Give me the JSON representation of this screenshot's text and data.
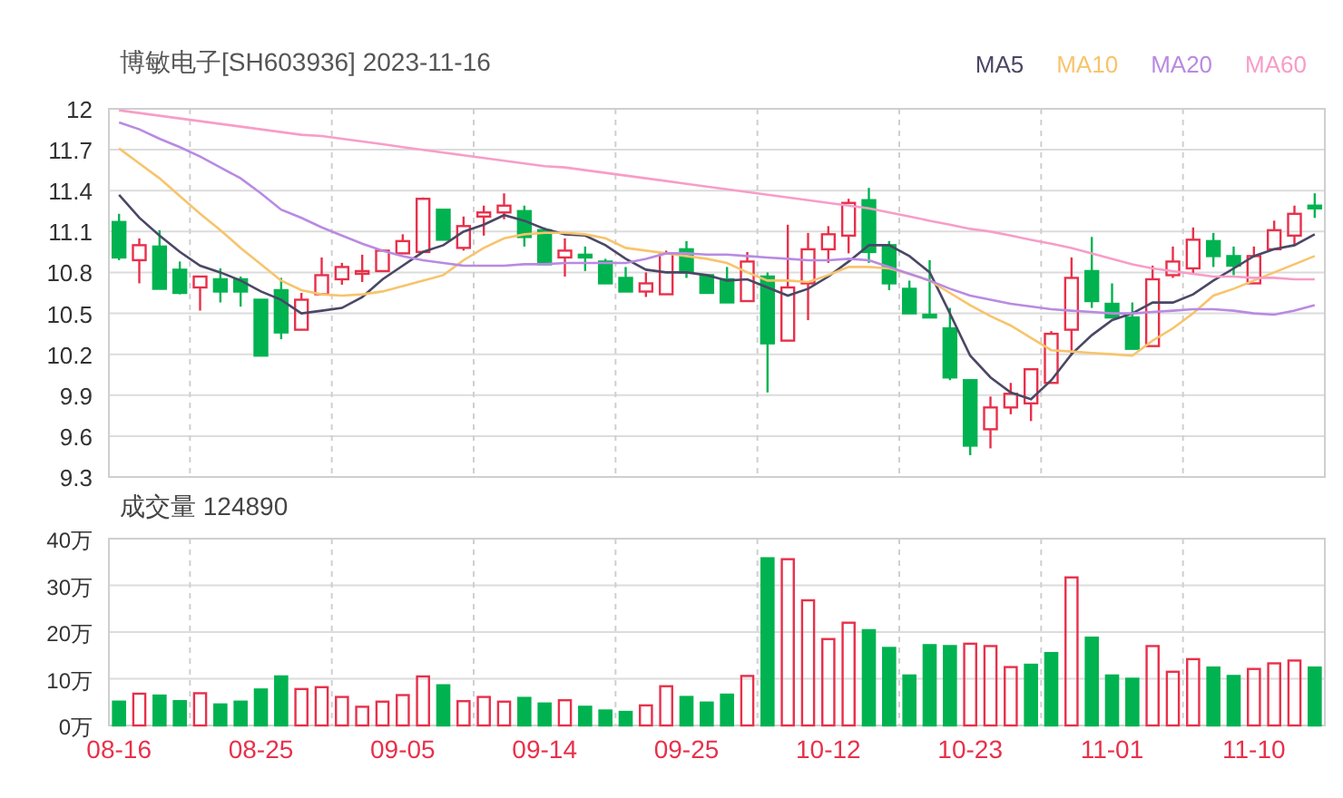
{
  "title": "博敏电子[SH603936] 2023-11-16",
  "price_chart": {
    "candles": {
      "chart_data": {
        "type": "candlestick",
        "grid": true,
        "categories": [
          null,
          null,
          null,
          null,
          null,
          null,
          null,
          null,
          null,
          null,
          null,
          null,
          null,
          null,
          null,
          null,
          null,
          null,
          null,
          null,
          null,
          null,
          null,
          null,
          null,
          null,
          null,
          null,
          null,
          null,
          null,
          null,
          null,
          null,
          null,
          null,
          null,
          null,
          null,
          null,
          null,
          null,
          null,
          null,
          null,
          null,
          null,
          null,
          null,
          null,
          null,
          null,
          null,
          null,
          null,
          null,
          null,
          null,
          null,
          null
        ],
        "ylim": [
          9.3,
          12
        ],
        "yticks": [
          {
            "value": 12,
            "label": "12"
          },
          {
            "value": 11.7,
            "label": "11.7"
          },
          {
            "value": 11.4,
            "label": "11.4"
          },
          {
            "value": 11.1,
            "label": "11.1"
          },
          {
            "value": 10.8,
            "label": "10.8"
          },
          {
            "value": 10.5,
            "label": "10.5"
          },
          {
            "value": 10.2,
            "label": "10.2"
          },
          {
            "value": 9.9,
            "label": "9.9"
          },
          {
            "value": 9.6,
            "label": "9.6"
          },
          {
            "value": 9.3,
            "label": "9.3"
          }
        ],
        "ohlc": [
          [
            11.17,
            11.23,
            10.89,
            10.91
          ],
          [
            10.89,
            11.05,
            10.72,
            11.0
          ],
          [
            10.99,
            11.11,
            10.68,
            10.68
          ],
          [
            10.82,
            10.88,
            10.64,
            10.65
          ],
          [
            10.69,
            10.77,
            10.52,
            10.77
          ],
          [
            10.75,
            10.83,
            10.58,
            10.66
          ],
          [
            10.75,
            10.77,
            10.55,
            10.66
          ],
          [
            10.6,
            10.6,
            10.19,
            10.19
          ],
          [
            10.67,
            10.76,
            10.31,
            10.36
          ],
          [
            10.38,
            10.65,
            10.38,
            10.6
          ],
          [
            10.64,
            10.91,
            10.64,
            10.78
          ],
          [
            10.75,
            10.87,
            10.71,
            10.84
          ],
          [
            10.8,
            10.93,
            10.73,
            10.81
          ],
          [
            10.81,
            10.97,
            10.81,
            10.96
          ],
          [
            10.94,
            11.08,
            10.94,
            11.03
          ],
          [
            10.95,
            11.35,
            10.95,
            11.34
          ],
          [
            11.26,
            11.26,
            11.04,
            11.04
          ],
          [
            10.98,
            11.21,
            10.96,
            11.14
          ],
          [
            11.21,
            11.29,
            11.07,
            11.24
          ],
          [
            11.24,
            11.38,
            11.19,
            11.29
          ],
          [
            11.25,
            11.29,
            10.99,
            11.06
          ],
          [
            11.11,
            11.13,
            10.86,
            10.86
          ],
          [
            10.91,
            11.05,
            10.77,
            10.96
          ],
          [
            10.93,
            10.99,
            10.81,
            10.92
          ],
          [
            10.88,
            10.9,
            10.72,
            10.72
          ],
          [
            10.76,
            10.84,
            10.66,
            10.66
          ],
          [
            10.66,
            10.8,
            10.62,
            10.72
          ],
          [
            10.64,
            10.96,
            10.64,
            10.94
          ],
          [
            10.97,
            11.03,
            10.76,
            10.8
          ],
          [
            10.78,
            10.78,
            10.65,
            10.65
          ],
          [
            10.75,
            10.84,
            10.58,
            10.58
          ],
          [
            10.59,
            10.95,
            10.59,
            10.88
          ],
          [
            10.77,
            10.8,
            9.92,
            10.28
          ],
          [
            10.3,
            11.15,
            10.3,
            10.69
          ],
          [
            10.72,
            11.09,
            10.45,
            10.97
          ],
          [
            10.97,
            11.14,
            10.87,
            11.08
          ],
          [
            11.07,
            11.34,
            10.94,
            11.31
          ],
          [
            11.33,
            11.42,
            10.87,
            10.95
          ],
          [
            11.0,
            11.03,
            10.67,
            10.72
          ],
          [
            10.68,
            10.74,
            10.5,
            10.5
          ],
          [
            10.49,
            10.89,
            10.47,
            10.47
          ],
          [
            10.39,
            10.54,
            10.01,
            10.03
          ],
          [
            10.01,
            10.01,
            9.46,
            9.53
          ],
          [
            9.65,
            9.89,
            9.51,
            9.81
          ],
          [
            9.81,
            9.99,
            9.76,
            9.91
          ],
          [
            9.84,
            10.09,
            9.71,
            10.09
          ],
          [
            9.99,
            10.37,
            9.99,
            10.35
          ],
          [
            10.38,
            10.91,
            10.19,
            10.76
          ],
          [
            10.81,
            11.06,
            10.54,
            10.59
          ],
          [
            10.57,
            10.72,
            10.47,
            10.47
          ],
          [
            10.47,
            10.58,
            10.24,
            10.24
          ],
          [
            10.26,
            10.85,
            10.26,
            10.75
          ],
          [
            10.78,
            10.99,
            10.76,
            10.88
          ],
          [
            10.83,
            11.13,
            10.79,
            11.04
          ],
          [
            11.03,
            11.09,
            10.84,
            10.92
          ],
          [
            10.92,
            10.99,
            10.78,
            10.85
          ],
          [
            10.72,
            10.99,
            10.72,
            10.92
          ],
          [
            10.97,
            11.18,
            10.97,
            11.11
          ],
          [
            11.07,
            11.29,
            11.0,
            11.23
          ],
          [
            11.29,
            11.38,
            11.2,
            11.27
          ]
        ]
      }
    },
    "averages": {
      "chart_data": {
        "type": "line",
        "categories": [
          null,
          null,
          null,
          null,
          null,
          null,
          null,
          null,
          null,
          null,
          null,
          null,
          null,
          null,
          null,
          null,
          null,
          null,
          null,
          null,
          null,
          null,
          null,
          null,
          null,
          null,
          null,
          null,
          null,
          null,
          null,
          null,
          null,
          null,
          null,
          null,
          null,
          null,
          null,
          null,
          null,
          null,
          null,
          null,
          null,
          null,
          null,
          null,
          null,
          null,
          null,
          null,
          null,
          null,
          null,
          null,
          null,
          null,
          null,
          null
        ],
        "ylim": [
          9.3,
          12
        ],
        "series": [
          {
            "name": "MA5",
            "color": "#4a4766",
            "values": [
              11.37,
              11.2,
              11.07,
              10.95,
              10.85,
              10.8,
              10.74,
              10.66,
              10.6,
              10.5,
              10.52,
              10.54,
              10.62,
              10.75,
              10.85,
              10.95,
              11.0,
              11.1,
              11.15,
              11.22,
              11.18,
              11.12,
              11.08,
              11.07,
              11.0,
              10.9,
              10.82,
              10.8,
              10.8,
              10.78,
              10.74,
              10.75,
              10.69,
              10.63,
              10.68,
              10.77,
              10.88,
              11.0,
              11.0,
              10.92,
              10.8,
              10.5,
              10.19,
              10.03,
              9.92,
              9.87,
              10.01,
              10.2,
              10.34,
              10.45,
              10.5,
              10.58,
              10.58,
              10.64,
              10.74,
              10.83,
              10.92,
              10.97,
              11.0,
              11.08
            ]
          },
          {
            "name": "MA10",
            "color": "#f7c46c",
            "values": [
              11.71,
              11.6,
              11.49,
              11.36,
              11.23,
              11.11,
              10.98,
              10.86,
              10.74,
              10.67,
              10.64,
              10.63,
              10.64,
              10.66,
              10.7,
              10.74,
              10.78,
              10.89,
              10.98,
              11.05,
              11.08,
              11.09,
              11.09,
              11.08,
              11.05,
              10.98,
              10.96,
              10.94,
              10.92,
              10.9,
              10.87,
              10.8,
              10.74,
              10.74,
              10.73,
              10.78,
              10.84,
              10.84,
              10.83,
              10.79,
              10.74,
              10.65,
              10.56,
              10.48,
              10.41,
              10.32,
              10.23,
              10.22,
              10.21,
              10.2,
              10.19,
              10.3,
              10.39,
              10.5,
              10.63,
              10.68,
              10.74,
              10.8,
              10.86,
              10.92
            ]
          },
          {
            "name": "MA20",
            "color": "#b98ae2",
            "values": [
              11.9,
              11.85,
              11.78,
              11.72,
              11.65,
              11.57,
              11.49,
              11.38,
              11.26,
              11.2,
              11.13,
              11.07,
              11.01,
              10.96,
              10.92,
              10.89,
              10.87,
              10.85,
              10.85,
              10.85,
              10.86,
              10.86,
              10.87,
              10.87,
              10.87,
              10.87,
              10.9,
              10.94,
              10.94,
              10.93,
              10.93,
              10.92,
              10.91,
              10.9,
              10.89,
              10.89,
              10.9,
              10.89,
              10.84,
              10.79,
              10.74,
              10.68,
              10.63,
              10.6,
              10.57,
              10.55,
              10.53,
              10.52,
              10.51,
              10.5,
              10.5,
              10.51,
              10.52,
              10.53,
              10.53,
              10.52,
              10.5,
              10.49,
              10.52,
              10.56
            ]
          },
          {
            "name": "MA60",
            "color": "#f79dc8",
            "values": [
              11.99,
              11.97,
              11.95,
              11.93,
              11.91,
              11.89,
              11.87,
              11.85,
              11.83,
              11.81,
              11.8,
              11.78,
              11.76,
              11.74,
              11.72,
              11.7,
              11.68,
              11.66,
              11.64,
              11.62,
              11.6,
              11.58,
              11.57,
              11.55,
              11.53,
              11.51,
              11.49,
              11.47,
              11.45,
              11.43,
              11.41,
              11.39,
              11.37,
              11.35,
              11.33,
              11.31,
              11.29,
              11.27,
              11.24,
              11.21,
              11.18,
              11.15,
              11.12,
              11.1,
              11.07,
              11.04,
              11.01,
              10.98,
              10.94,
              10.9,
              10.86,
              10.83,
              10.81,
              10.79,
              10.77,
              10.77,
              10.76,
              10.76,
              10.75,
              10.75
            ]
          }
        ]
      }
    }
  },
  "volume_chart": {
    "title": "成交量 124890",
    "chart_data": {
      "type": "bar",
      "stacked": true,
      "grid": true,
      "ylim": [
        0,
        40
      ],
      "categories": [
        "08-16",
        null,
        null,
        null,
        null,
        null,
        null,
        "08-25",
        null,
        null,
        null,
        null,
        null,
        null,
        "09-05",
        null,
        null,
        null,
        null,
        null,
        null,
        "09-14",
        null,
        null,
        null,
        null,
        null,
        null,
        "09-25",
        null,
        null,
        null,
        null,
        null,
        null,
        "10-12",
        null,
        null,
        null,
        null,
        null,
        null,
        "10-23",
        null,
        null,
        null,
        null,
        null,
        null,
        "11-01",
        null,
        null,
        null,
        null,
        null,
        null,
        "11-10",
        null,
        null,
        null
      ],
      "yticks": [
        {
          "value": 40,
          "label": "40万"
        },
        {
          "value": 30,
          "label": "30万"
        },
        {
          "value": 20,
          "label": "20万"
        },
        {
          "value": 10,
          "label": "10万"
        },
        {
          "value": 0,
          "label": "0万"
        }
      ],
      "series": [
        {
          "color": "#e8304a",
          "values": [
            null,
            6.8,
            null,
            null,
            6.9,
            null,
            null,
            null,
            null,
            7.8,
            8.2,
            6.1,
            4.0,
            5.1,
            6.5,
            10.5,
            null,
            5.2,
            6.1,
            5.1,
            null,
            null,
            5.4,
            null,
            null,
            null,
            4.3,
            8.4,
            null,
            null,
            null,
            10.6,
            null,
            35.6,
            26.8,
            18.5,
            22.0,
            null,
            null,
            null,
            null,
            null,
            17.5,
            17.0,
            12.5,
            null,
            null,
            31.7,
            null,
            null,
            null,
            17.0,
            11.5,
            14.2,
            null,
            null,
            12.1,
            13.3,
            13.9,
            null
          ]
        },
        {
          "color": "#00b350",
          "values": [
            5.1,
            null,
            6.4,
            5.2,
            null,
            4.5,
            5.1,
            7.7,
            10.5,
            null,
            null,
            null,
            null,
            null,
            null,
            null,
            8.6,
            null,
            null,
            null,
            5.9,
            4.7,
            null,
            4.0,
            3.2,
            2.9,
            null,
            null,
            6.1,
            4.9,
            6.6,
            null,
            35.8,
            null,
            null,
            null,
            null,
            20.4,
            16.6,
            10.7,
            17.2,
            17.0,
            null,
            null,
            null,
            13.0,
            15.5,
            null,
            18.8,
            10.7,
            10.0,
            null,
            null,
            null,
            12.4,
            10.6,
            null,
            null,
            null,
            12.4
          ]
        }
      ]
    }
  }
}
